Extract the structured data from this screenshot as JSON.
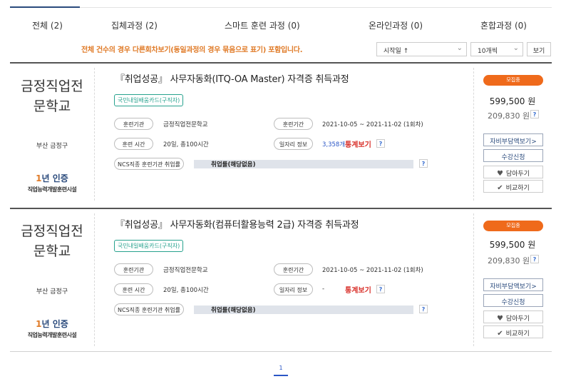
{
  "tabs": [
    {
      "label": "전체 (2)",
      "active": true
    },
    {
      "label": "집체과정 (2)"
    },
    {
      "label": "스마트 훈련 과정 (0)"
    },
    {
      "label": "온라인과정 (0)"
    },
    {
      "label": "혼합과정 (0)"
    }
  ],
  "notice": "전체 건수의 경우 다른회차보기(동일과정의 경우 묶음으로 표기) 포함입니다.",
  "sort": {
    "selected": "시작일 ↑"
  },
  "per_page": {
    "selected": "10개씩"
  },
  "view_button": "보기",
  "courses": [
    {
      "org_line1": "금정직업전",
      "org_line2": "문학교",
      "region": "부산 금정구",
      "cert_mark_a": "1",
      "cert_mark_b": "년 인증",
      "cert_sub": "직업능력개발훈련시설",
      "title": "『취업성공』 사무자동화(ITQ-OA Master) 자격증 취득과정",
      "tag": "국민내일배움카드(구직자)",
      "label_org": "훈련기관",
      "org": "금정직업전문학교",
      "label_period": "훈련기간",
      "period": "2021-10-05 ~ 2021-11-02 (1회차)",
      "label_time": "훈련 시간",
      "time": "20일, 총100시간",
      "label_job": "일자리 정보",
      "job_count": "3,358개",
      "stat_link": "통계보기",
      "label_ncs": "NCS직종 훈련기관 취업률",
      "employment": "취업률(해당없음)",
      "status": "모집중",
      "price": "599,500 원",
      "self_pay": "209,830 원",
      "btn_self_pay": "자비부담액보기>",
      "btn_apply": "수강신청",
      "btn_wish": "담아두기",
      "btn_compare": "비교하기",
      "q": "?"
    },
    {
      "org_line1": "금정직업전",
      "org_line2": "문학교",
      "region": "부산 금정구",
      "cert_mark_a": "1",
      "cert_mark_b": "년 인증",
      "cert_sub": "직업능력개발훈련시설",
      "title": "『취업성공』 사무자동화(컴퓨터활용능력 2급) 자격증 취득과정",
      "tag": "국민내일배움카드(구직자)",
      "label_org": "훈련기관",
      "org": "금정직업전문학교",
      "label_period": "훈련기간",
      "period": "2021-10-05 ~ 2021-11-02 (1회차)",
      "label_time": "훈련 시간",
      "time": "20일, 총100시간",
      "label_job": "일자리 정보",
      "job_count": "-",
      "stat_link": "통계보기",
      "label_ncs": "NCS직종 훈련기관 취업률",
      "employment": "취업률(해당없음)",
      "status": "모집중",
      "price": "599,500 원",
      "self_pay": "209,830 원",
      "btn_self_pay": "자비부담액보기>",
      "btn_apply": "수강신청",
      "btn_wish": "담아두기",
      "btn_compare": "비교하기",
      "q": "?"
    }
  ],
  "pagination": {
    "current": "1"
  }
}
